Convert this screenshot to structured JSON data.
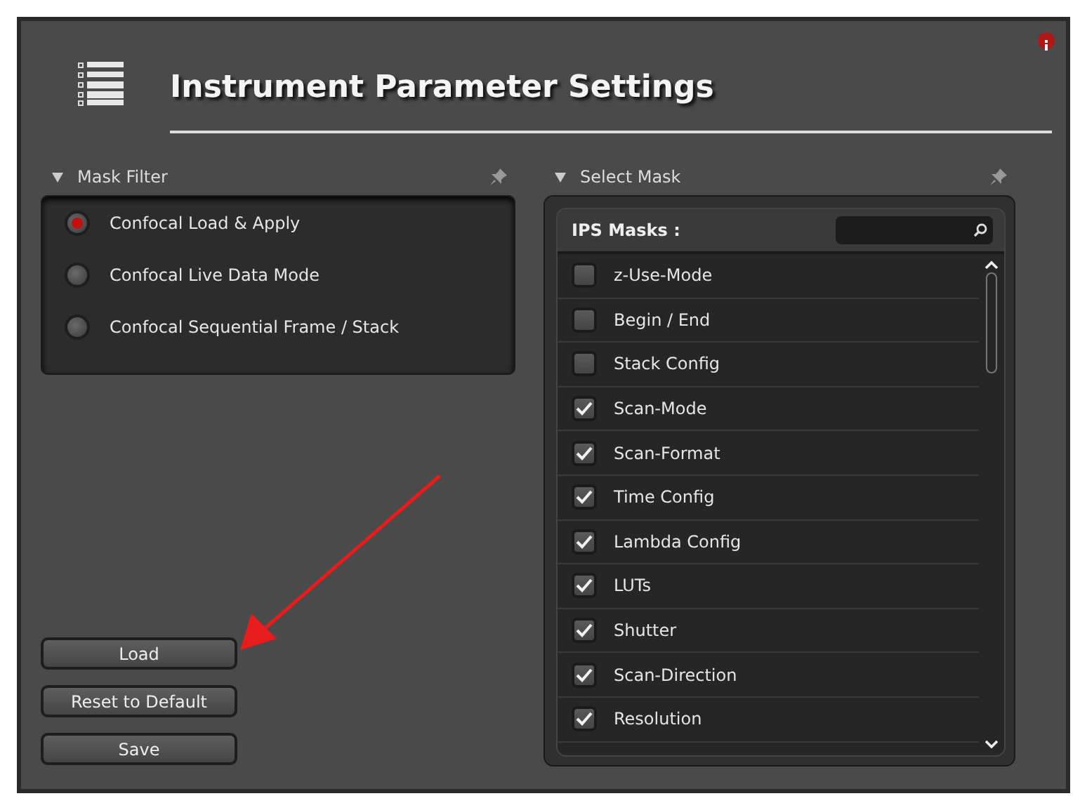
{
  "window": {
    "title": "Instrument Parameter Settings"
  },
  "mask_filter": {
    "title": "Mask Filter",
    "options": [
      {
        "label": "Confocal Load & Apply",
        "selected": true
      },
      {
        "label": "Confocal Live Data Mode",
        "selected": false
      },
      {
        "label": "Confocal Sequential Frame / Stack",
        "selected": false
      }
    ]
  },
  "buttons": [
    "Load",
    "Reset to Default",
    "Save"
  ],
  "select_mask": {
    "title": "Select Mask",
    "list_title": "IPS Masks :",
    "items": [
      {
        "label": "z-Use-Mode",
        "checked": false
      },
      {
        "label": "Begin / End",
        "checked": false
      },
      {
        "label": "Stack Config",
        "checked": false
      },
      {
        "label": "Scan-Mode",
        "checked": true
      },
      {
        "label": "Scan-Format",
        "checked": true
      },
      {
        "label": "Time Config",
        "checked": true
      },
      {
        "label": "Lambda Config",
        "checked": true
      },
      {
        "label": "LUTs",
        "checked": true
      },
      {
        "label": "Shutter",
        "checked": true
      },
      {
        "label": "Scan-Direction",
        "checked": true
      },
      {
        "label": "Resolution",
        "checked": true
      }
    ]
  }
}
